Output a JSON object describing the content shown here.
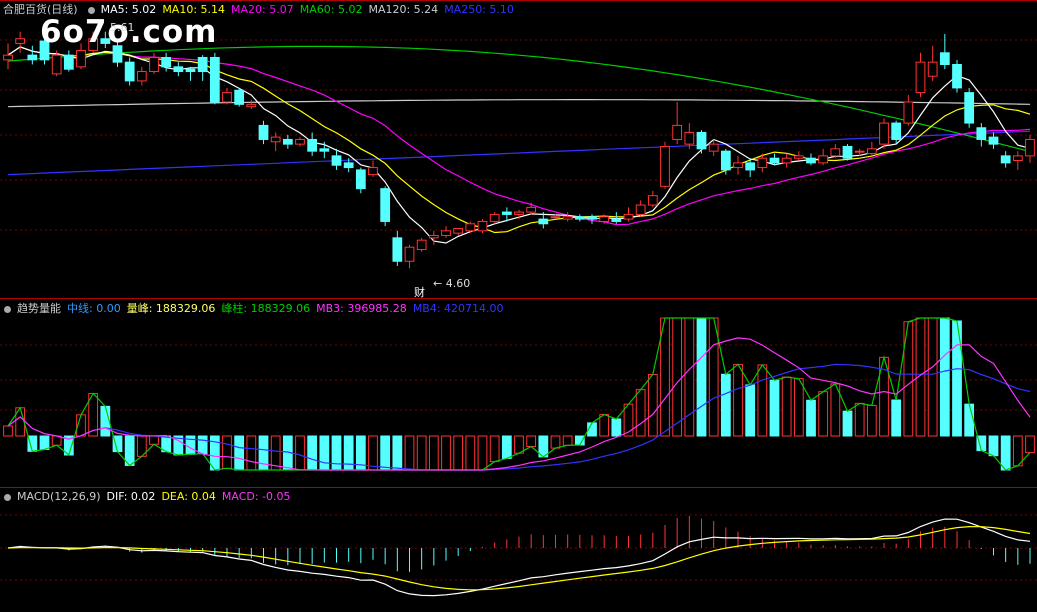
{
  "panels": {
    "price": {
      "title": "合肥百货(日线)",
      "ma": [
        {
          "label": "MA5: 5.02",
          "color": "#ffffff"
        },
        {
          "label": "MA10: 5.14",
          "color": "#ffff00"
        },
        {
          "label": "MA20: 5.07",
          "color": "#ff00ff"
        },
        {
          "label": "MA60: 5.02",
          "color": "#00cc00"
        },
        {
          "label": "MA120: 5.24",
          "color": "#cccccc"
        },
        {
          "label": "MA250: 5.10",
          "color": "#3333ff"
        }
      ]
    },
    "volume": {
      "title": "趋势量能",
      "items": [
        {
          "label": "中线: 0.00",
          "color": "#3399ff"
        },
        {
          "label": "量峰: 188329.06",
          "color": "#ffff66"
        },
        {
          "label": "峰柱: 188329.06",
          "color": "#00cc00"
        },
        {
          "label": "MB3: 396985.28",
          "color": "#ff33ff"
        },
        {
          "label": "MB4: 420714.00",
          "color": "#3333ff"
        }
      ]
    },
    "macd": {
      "title": "MACD(12,26,9)",
      "items": [
        {
          "label": "DIF: 0.02",
          "color": "#ffffff"
        },
        {
          "label": "DEA: 0.04",
          "color": "#ffff00"
        },
        {
          "label": "MACD: -0.05",
          "color": "#ff33ff"
        }
      ]
    }
  },
  "watermark": "6o7o.com",
  "annotations": {
    "high": "5.61",
    "low": "← 4.60",
    "tag": "财"
  },
  "colors": {
    "up": "#ff3333",
    "down": "#55ffff",
    "grid": "#8b0000"
  },
  "chart_data": {
    "type": "candlestick",
    "candles": [
      {
        "o": 5.49,
        "c": 5.51,
        "h": 5.56,
        "l": 5.45
      },
      {
        "o": 5.56,
        "c": 5.58,
        "h": 5.61,
        "l": 5.52
      },
      {
        "o": 5.51,
        "c": 5.49,
        "h": 5.55,
        "l": 5.47
      },
      {
        "o": 5.57,
        "c": 5.49,
        "h": 5.58,
        "l": 5.47
      },
      {
        "o": 5.43,
        "c": 5.51,
        "h": 5.53,
        "l": 5.42
      },
      {
        "o": 5.51,
        "c": 5.45,
        "h": 5.53,
        "l": 5.44
      },
      {
        "o": 5.46,
        "c": 5.53,
        "h": 5.56,
        "l": 5.45
      },
      {
        "o": 5.53,
        "c": 5.58,
        "h": 5.61,
        "l": 5.52
      },
      {
        "o": 5.58,
        "c": 5.56,
        "h": 5.61,
        "l": 5.54
      },
      {
        "o": 5.55,
        "c": 5.48,
        "h": 5.58,
        "l": 5.46
      },
      {
        "o": 5.48,
        "c": 5.4,
        "h": 5.5,
        "l": 5.38
      },
      {
        "o": 5.4,
        "c": 5.44,
        "h": 5.46,
        "l": 5.38
      },
      {
        "o": 5.44,
        "c": 5.5,
        "h": 5.52,
        "l": 5.43
      },
      {
        "o": 5.5,
        "c": 5.46,
        "h": 5.52,
        "l": 5.44
      },
      {
        "o": 5.46,
        "c": 5.44,
        "h": 5.48,
        "l": 5.42
      },
      {
        "o": 5.45,
        "c": 5.44,
        "h": 5.46,
        "l": 5.4
      },
      {
        "o": 5.5,
        "c": 5.44,
        "h": 5.51,
        "l": 5.4
      },
      {
        "o": 5.5,
        "c": 5.31,
        "h": 5.52,
        "l": 5.3
      },
      {
        "o": 5.31,
        "c": 5.35,
        "h": 5.37,
        "l": 5.3
      },
      {
        "o": 5.36,
        "c": 5.3,
        "h": 5.37,
        "l": 5.29
      },
      {
        "o": 5.29,
        "c": 5.3,
        "h": 5.32,
        "l": 5.28
      },
      {
        "o": 5.21,
        "c": 5.15,
        "h": 5.23,
        "l": 5.13
      },
      {
        "o": 5.14,
        "c": 5.16,
        "h": 5.18,
        "l": 5.1
      },
      {
        "o": 5.15,
        "c": 5.13,
        "h": 5.17,
        "l": 5.11
      },
      {
        "o": 5.13,
        "c": 5.15,
        "h": 5.16,
        "l": 5.12
      },
      {
        "o": 5.15,
        "c": 5.1,
        "h": 5.18,
        "l": 5.08
      },
      {
        "o": 5.11,
        "c": 5.1,
        "h": 5.14,
        "l": 5.07
      },
      {
        "o": 5.08,
        "c": 5.04,
        "h": 5.11,
        "l": 5.02
      },
      {
        "o": 5.05,
        "c": 5.03,
        "h": 5.07,
        "l": 5.01
      },
      {
        "o": 5.02,
        "c": 4.94,
        "h": 5.03,
        "l": 4.92
      },
      {
        "o": 5.0,
        "c": 5.03,
        "h": 5.06,
        "l": 4.99
      },
      {
        "o": 4.94,
        "c": 4.8,
        "h": 4.95,
        "l": 4.78
      },
      {
        "o": 4.73,
        "c": 4.63,
        "h": 4.76,
        "l": 4.61
      },
      {
        "o": 4.63,
        "c": 4.69,
        "h": 4.7,
        "l": 4.6
      },
      {
        "o": 4.68,
        "c": 4.72,
        "h": 4.73,
        "l": 4.67
      },
      {
        "o": 4.73,
        "c": 4.74,
        "h": 4.76,
        "l": 4.7
      },
      {
        "o": 4.74,
        "c": 4.76,
        "h": 4.78,
        "l": 4.73
      },
      {
        "o": 4.75,
        "c": 4.77,
        "h": 4.77,
        "l": 4.74
      },
      {
        "o": 4.76,
        "c": 4.79,
        "h": 4.8,
        "l": 4.75
      },
      {
        "o": 4.76,
        "c": 4.8,
        "h": 4.81,
        "l": 4.75
      },
      {
        "o": 4.8,
        "c": 4.83,
        "h": 4.84,
        "l": 4.79
      },
      {
        "o": 4.84,
        "c": 4.83,
        "h": 4.86,
        "l": 4.8
      },
      {
        "o": 4.83,
        "c": 4.84,
        "h": 4.85,
        "l": 4.81
      },
      {
        "o": 4.84,
        "c": 4.86,
        "h": 4.88,
        "l": 4.83
      },
      {
        "o": 4.81,
        "c": 4.79,
        "h": 4.84,
        "l": 4.77
      },
      {
        "o": 4.82,
        "c": 4.82,
        "h": 4.83,
        "l": 4.81
      },
      {
        "o": 4.81,
        "c": 4.82,
        "h": 4.84,
        "l": 4.8
      },
      {
        "o": 4.82,
        "c": 4.81,
        "h": 4.83,
        "l": 4.8
      },
      {
        "o": 4.82,
        "c": 4.81,
        "h": 4.83,
        "l": 4.79
      },
      {
        "o": 4.8,
        "c": 4.82,
        "h": 4.83,
        "l": 4.79
      },
      {
        "o": 4.81,
        "c": 4.8,
        "h": 4.84,
        "l": 4.79
      },
      {
        "o": 4.81,
        "c": 4.83,
        "h": 4.86,
        "l": 4.8
      },
      {
        "o": 4.83,
        "c": 4.87,
        "h": 4.89,
        "l": 4.82
      },
      {
        "o": 4.87,
        "c": 4.91,
        "h": 4.93,
        "l": 4.86
      },
      {
        "o": 4.95,
        "c": 5.12,
        "h": 5.14,
        "l": 4.94
      },
      {
        "o": 5.15,
        "c": 5.21,
        "h": 5.31,
        "l": 5.13
      },
      {
        "o": 5.13,
        "c": 5.18,
        "h": 5.22,
        "l": 5.11
      },
      {
        "o": 5.18,
        "c": 5.11,
        "h": 5.19,
        "l": 5.09
      },
      {
        "o": 5.1,
        "c": 5.13,
        "h": 5.15,
        "l": 5.08
      },
      {
        "o": 5.1,
        "c": 5.02,
        "h": 5.11,
        "l": 5.0
      },
      {
        "o": 5.03,
        "c": 5.05,
        "h": 5.08,
        "l": 5.0
      },
      {
        "o": 5.05,
        "c": 5.02,
        "h": 5.07,
        "l": 4.99
      },
      {
        "o": 5.03,
        "c": 5.07,
        "h": 5.09,
        "l": 5.01
      },
      {
        "o": 5.07,
        "c": 5.05,
        "h": 5.09,
        "l": 5.04
      },
      {
        "o": 5.05,
        "c": 5.07,
        "h": 5.09,
        "l": 5.03
      },
      {
        "o": 5.07,
        "c": 5.08,
        "h": 5.1,
        "l": 5.06
      },
      {
        "o": 5.07,
        "c": 5.05,
        "h": 5.09,
        "l": 5.04
      },
      {
        "o": 5.05,
        "c": 5.08,
        "h": 5.11,
        "l": 5.04
      },
      {
        "o": 5.08,
        "c": 5.11,
        "h": 5.13,
        "l": 5.07
      },
      {
        "o": 5.12,
        "c": 5.07,
        "h": 5.13,
        "l": 5.06
      },
      {
        "o": 5.1,
        "c": 5.1,
        "h": 5.11,
        "l": 5.08
      },
      {
        "o": 5.09,
        "c": 5.11,
        "h": 5.14,
        "l": 5.08
      },
      {
        "o": 5.13,
        "c": 5.22,
        "h": 5.24,
        "l": 5.11
      },
      {
        "o": 5.22,
        "c": 5.15,
        "h": 5.23,
        "l": 5.13
      },
      {
        "o": 5.22,
        "c": 5.31,
        "h": 5.34,
        "l": 5.21
      },
      {
        "o": 5.35,
        "c": 5.48,
        "h": 5.52,
        "l": 5.33
      },
      {
        "o": 5.42,
        "c": 5.48,
        "h": 5.55,
        "l": 5.4
      },
      {
        "o": 5.52,
        "c": 5.47,
        "h": 5.6,
        "l": 5.45
      },
      {
        "o": 5.47,
        "c": 5.37,
        "h": 5.49,
        "l": 5.35
      },
      {
        "o": 5.35,
        "c": 5.22,
        "h": 5.37,
        "l": 5.2
      },
      {
        "o": 5.2,
        "c": 5.15,
        "h": 5.22,
        "l": 5.12
      },
      {
        "o": 5.16,
        "c": 5.13,
        "h": 5.18,
        "l": 5.11
      },
      {
        "o": 5.08,
        "c": 5.05,
        "h": 5.1,
        "l": 5.03
      },
      {
        "o": 5.06,
        "c": 5.08,
        "h": 5.1,
        "l": 5.02
      },
      {
        "o": 5.08,
        "c": 5.15,
        "h": 5.17,
        "l": 5.05
      }
    ]
  }
}
